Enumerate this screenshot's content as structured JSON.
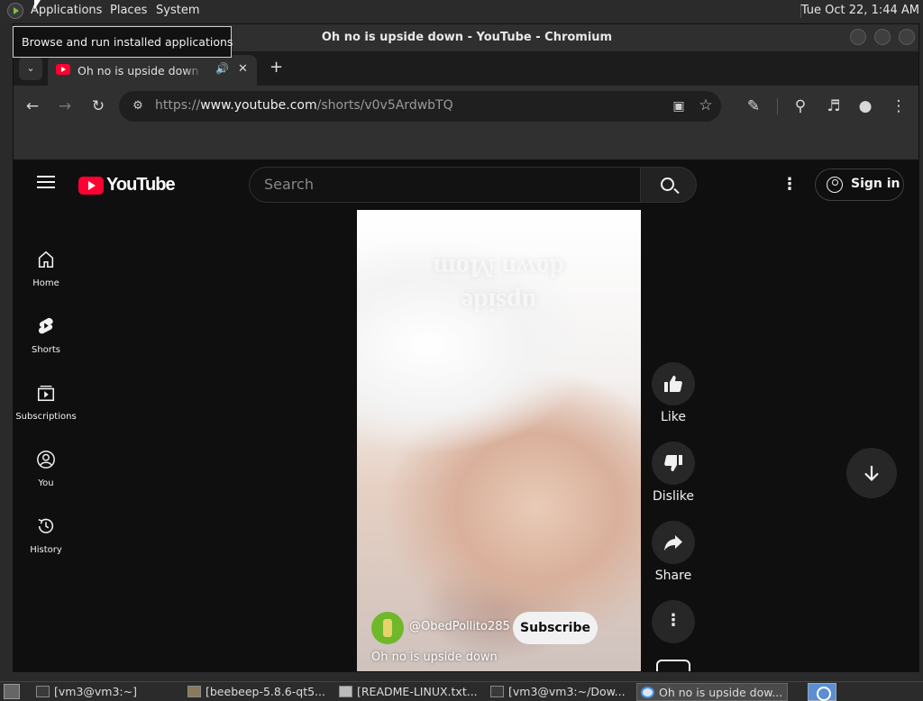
{
  "panel": {
    "menus": [
      "Applications",
      "Places",
      "System"
    ],
    "clock": "Tue Oct 22,  1:44 AM"
  },
  "tooltip": "Browse and run installed applications",
  "window": {
    "title": "Oh no is upside down - YouTube - Chromium"
  },
  "tab": {
    "title": "Oh no is upside down - YouTube"
  },
  "omnibox": {
    "scheme": "https://",
    "host": "www.youtube.com",
    "path": "/shorts/v0v5ArdwbTQ"
  },
  "youtube": {
    "logo_text": "YouTube",
    "search_placeholder": "Search",
    "signin_label": "Sign in",
    "guide": [
      "Home",
      "Shorts",
      "Subscriptions",
      "You",
      "History"
    ],
    "short": {
      "channel": "@ObedPollito285",
      "subscribe_label": "Subscribe",
      "title": "Oh no is upside down",
      "overlay_text": "upside\ndown Mom"
    },
    "actions": {
      "like": "Like",
      "dislike": "Dislike",
      "share": "Share"
    }
  },
  "taskbar": {
    "items": [
      "[vm3@vm3:~]",
      "[beebeep-5.8.6-qt5...",
      "[README-LINUX.txt...",
      "[vm3@vm3:~/Dow...",
      "Oh no is upside dow..."
    ]
  },
  "colors": {
    "youtube_red": "#ff0033",
    "page_bg": "#0f0f0f",
    "chrome_toolbar": "#303030"
  }
}
